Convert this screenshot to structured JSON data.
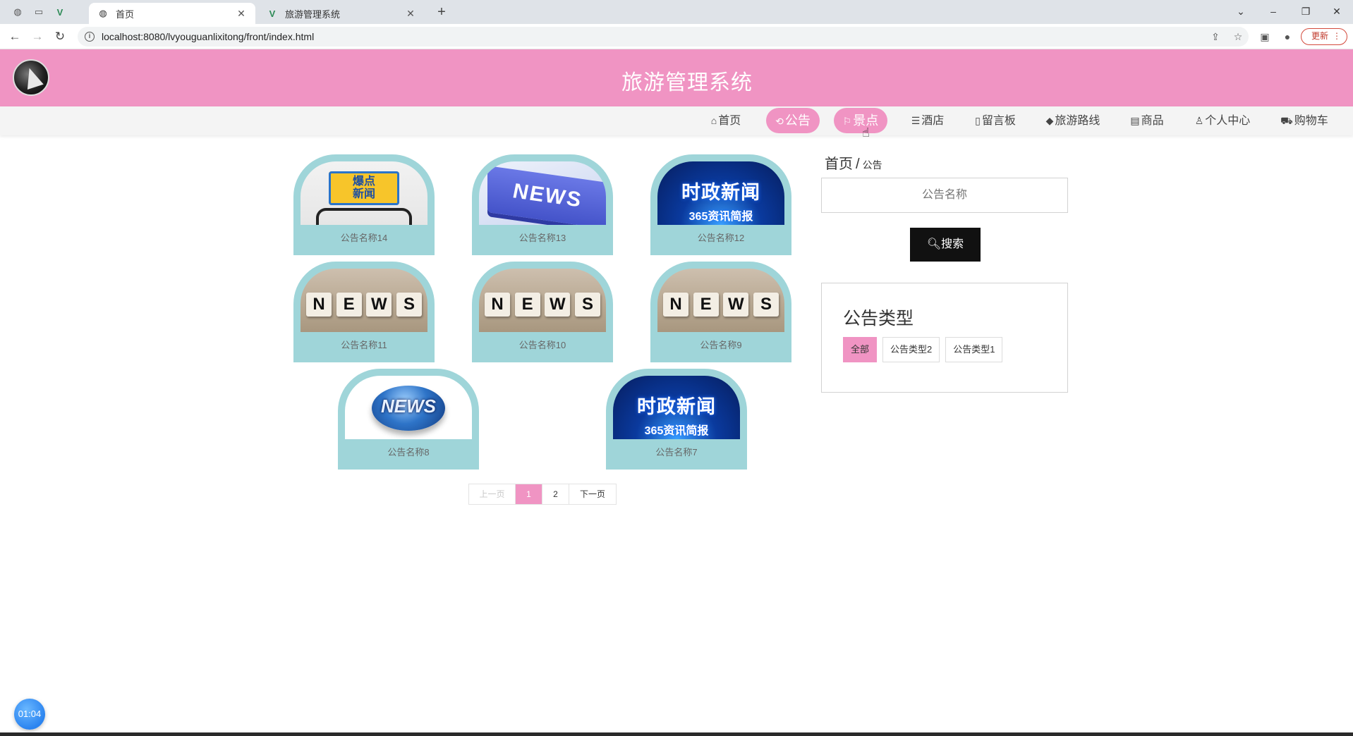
{
  "browser": {
    "tabs": [
      {
        "title": "首页",
        "active": true
      },
      {
        "title": "旅游管理系统",
        "active": false
      }
    ],
    "url": "localhost:8080/lvyouguanlixitong/front/index.html",
    "update_label": "更新"
  },
  "site": {
    "title": "旅游管理系统",
    "menu": [
      {
        "label": "首页",
        "icon": "home-icon",
        "glyph": "⌂"
      },
      {
        "label": "公告",
        "icon": "refresh-icon",
        "glyph": "⟲"
      },
      {
        "label": "景点",
        "icon": "flag-icon",
        "glyph": "⚐"
      },
      {
        "label": "酒店",
        "icon": "sliders-icon",
        "glyph": "☰"
      },
      {
        "label": "留言板",
        "icon": "book-icon",
        "glyph": "▯"
      },
      {
        "label": "旅游路线",
        "icon": "cap-icon",
        "glyph": "◆"
      },
      {
        "label": "商品",
        "icon": "doc-icon",
        "glyph": "▤"
      },
      {
        "label": "个人中心",
        "icon": "user-icon",
        "glyph": "♙"
      },
      {
        "label": "购物车",
        "icon": "cart-icon",
        "glyph": "⛟"
      }
    ]
  },
  "notices": [
    {
      "name": "公告名称14",
      "image": "explosive-news"
    },
    {
      "name": "公告名称13",
      "image": "news-key"
    },
    {
      "name": "公告名称12",
      "image": "politics-news"
    },
    {
      "name": "公告名称11",
      "image": "news-dice"
    },
    {
      "name": "公告名称10",
      "image": "news-dice"
    },
    {
      "name": "公告名称9",
      "image": "news-dice"
    },
    {
      "name": "公告名称8",
      "image": "news-globe"
    },
    {
      "name": "公告名称7",
      "image": "politics-news"
    }
  ],
  "thumb_text": {
    "boom": "爆点\n新闻",
    "news_key": "NEWS",
    "politics_title": "时政新闻",
    "politics_sub": "365资讯简报",
    "dice": [
      "N",
      "E",
      "W",
      "S"
    ],
    "globe": "NEWS"
  },
  "pagination": {
    "prev": "上一页",
    "pages": [
      "1",
      "2"
    ],
    "current": "1",
    "next": "下一页"
  },
  "sidebar": {
    "breadcrumb_home": "首页",
    "breadcrumb_sep": "/",
    "breadcrumb_current": "公告",
    "search_placeholder": "公告名称",
    "search_button": "搜索",
    "type_title": "公告类型",
    "types": [
      "全部",
      "公告类型2",
      "公告类型1"
    ],
    "selected_type": "全部"
  },
  "timer": "01:04",
  "colors": {
    "brand_pink": "#f094c3",
    "card_teal": "#9fd5d9",
    "button_dark": "#111111"
  }
}
